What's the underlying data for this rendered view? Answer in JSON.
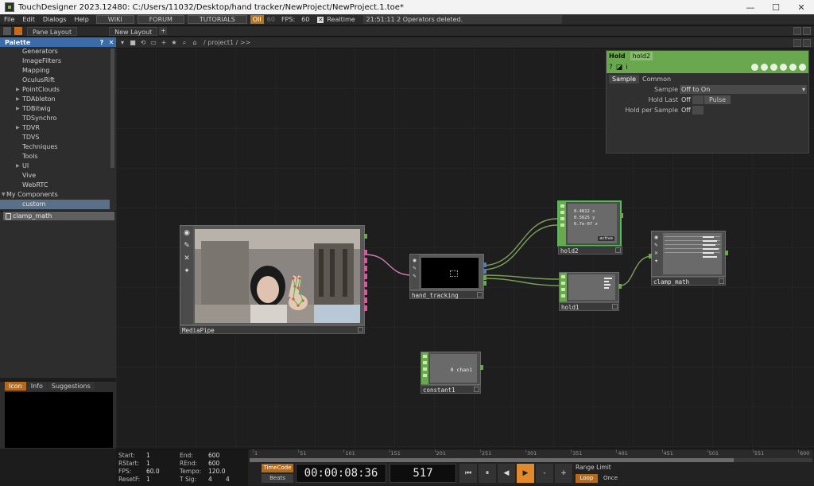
{
  "window": {
    "title": "TouchDesigner 2023.12480: C:/Users/11032/Desktop/hand tracker/NewProject/NewProject.1.toe*",
    "min": "—",
    "max": "☐",
    "close": "✕"
  },
  "menu": {
    "items": [
      "File",
      "Edit",
      "Dialogs",
      "Help"
    ],
    "links": [
      "WIKI",
      "FORUM",
      "TUTORIALS"
    ],
    "badge": "OII",
    "badge2": "60",
    "fps_label": "FPS:",
    "fps_value": "60",
    "realtime": "Realtime",
    "status": "21:51:11 2 Operators deleted."
  },
  "panebar": {
    "pane_layout": "Pane Layout",
    "new_layout": "New Layout",
    "plus": "+"
  },
  "palette": {
    "title": "Palette",
    "help": "?",
    "close": "✕",
    "items": [
      {
        "label": "Generators",
        "arrow": ""
      },
      {
        "label": "ImageFilters",
        "arrow": ""
      },
      {
        "label": "Mapping",
        "arrow": ""
      },
      {
        "label": "OculusRift",
        "arrow": ""
      },
      {
        "label": "PointClouds",
        "arrow": "▶"
      },
      {
        "label": "TDAbleton",
        "arrow": "▶"
      },
      {
        "label": "TDBitwig",
        "arrow": "▶"
      },
      {
        "label": "TDSynchro",
        "arrow": ""
      },
      {
        "label": "TDVR",
        "arrow": "▶"
      },
      {
        "label": "TDVS",
        "arrow": ""
      },
      {
        "label": "Techniques",
        "arrow": ""
      },
      {
        "label": "Tools",
        "arrow": ""
      },
      {
        "label": "UI",
        "arrow": "▶"
      },
      {
        "label": "Vive",
        "arrow": ""
      },
      {
        "label": "WebRTC",
        "arrow": ""
      },
      {
        "label": "My Components",
        "arrow": "▼"
      },
      {
        "label": "custom",
        "arrow": ""
      }
    ],
    "component": "clamp_math"
  },
  "info": {
    "tabs": [
      "Icon",
      "Info",
      "Suggestions"
    ]
  },
  "network": {
    "path": "/ project1 / >>",
    "nodes": {
      "mediapipe": "MediaPipe",
      "hand_tracking": "hand_tracking",
      "hold2": "hold2",
      "hold1": "hold1",
      "clamp_math": "clamp_math",
      "constant1": "constant1"
    },
    "hold2_values": [
      "0.4812 x",
      "0.5625 y",
      "6.7e-07 z"
    ],
    "hold2_tag": "active",
    "constant_text": "0 chan1"
  },
  "params": {
    "type": "Hold",
    "name": "hold2",
    "help": "?",
    "tabs": [
      "Sample",
      "Common"
    ],
    "sample_label": "Sample",
    "sample_value": "Off to On",
    "hold_last_label": "Hold Last",
    "hold_last_value": "Off",
    "pulse": "Pulse",
    "hold_per_label": "Hold per Sample",
    "hold_per_value": "Off"
  },
  "timeline": {
    "info": {
      "start_k": "Start:",
      "start_v": "1",
      "rstart_k": "RStart:",
      "rstart_v": "1",
      "fps_k": "FPS:",
      "fps_v": "60.0",
      "reset_k": "ResetF:",
      "reset_v": "1",
      "end_k": "End:",
      "end_v": "600",
      "rend_k": "REnd:",
      "rend_v": "600",
      "tempo_k": "Tempo:",
      "tempo_v": "120.0",
      "tsig_k": "T Sig:",
      "tsig_v1": "4",
      "tsig_v2": "4"
    },
    "ruler": [
      "1",
      "51",
      "101",
      "151",
      "201",
      "251",
      "301",
      "351",
      "401",
      "451",
      "501",
      "551",
      "600"
    ],
    "progress": 0.86,
    "timecode": "TimeCode",
    "beats": "Beats",
    "time": "00:00:08:36",
    "frame": "517",
    "range_limit": "Range Limit",
    "loop": "Loop",
    "once": "Once",
    "buttons": [
      "⏮",
      "⏸",
      "◀",
      "▶",
      "-",
      "+"
    ]
  }
}
